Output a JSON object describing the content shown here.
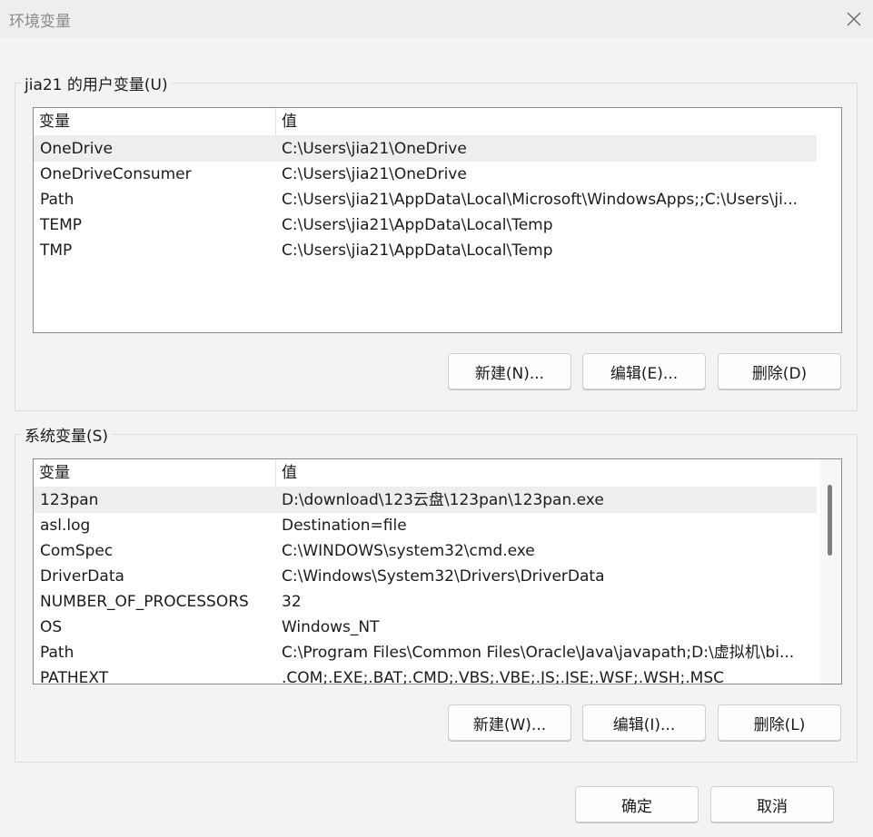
{
  "window": {
    "title": "环境变量",
    "close_icon": "close-icon"
  },
  "user_vars": {
    "legend": "jia21 的用户变量(U)",
    "columns": [
      "变量",
      "值"
    ],
    "rows": [
      {
        "name": "OneDrive",
        "value": "C:\\Users\\jia21\\OneDrive"
      },
      {
        "name": "OneDriveConsumer",
        "value": "C:\\Users\\jia21\\OneDrive"
      },
      {
        "name": "Path",
        "value": "C:\\Users\\jia21\\AppData\\Local\\Microsoft\\WindowsApps;;C:\\Users\\ji..."
      },
      {
        "name": "TEMP",
        "value": "C:\\Users\\jia21\\AppData\\Local\\Temp"
      },
      {
        "name": "TMP",
        "value": "C:\\Users\\jia21\\AppData\\Local\\Temp"
      }
    ],
    "selected_row": "OneDrive",
    "buttons": {
      "new": "新建(N)...",
      "edit": "编辑(E)...",
      "delete": "删除(D)"
    }
  },
  "system_vars": {
    "legend": "系统变量(S)",
    "columns": [
      "变量",
      "值"
    ],
    "rows": [
      {
        "name": "123pan",
        "value": "D:\\download\\123云盘\\123pan\\123pan.exe"
      },
      {
        "name": "asl.log",
        "value": "Destination=file"
      },
      {
        "name": "ComSpec",
        "value": "C:\\WINDOWS\\system32\\cmd.exe"
      },
      {
        "name": "DriverData",
        "value": "C:\\Windows\\System32\\Drivers\\DriverData"
      },
      {
        "name": "NUMBER_OF_PROCESSORS",
        "value": "32"
      },
      {
        "name": "OS",
        "value": "Windows_NT"
      },
      {
        "name": "Path",
        "value": "C:\\Program Files\\Common Files\\Oracle\\Java\\javapath;D:\\虚拟机\\bi..."
      },
      {
        "name": "PATHEXT",
        "value": ".COM;.EXE;.BAT;.CMD;.VBS;.VBE;.JS;.JSE;.WSF;.WSH;.MSC"
      }
    ],
    "selected_row": "123pan",
    "buttons": {
      "new": "新建(W)...",
      "edit": "编辑(I)...",
      "delete": "删除(L)"
    }
  },
  "footer": {
    "ok": "确定",
    "cancel": "取消"
  }
}
